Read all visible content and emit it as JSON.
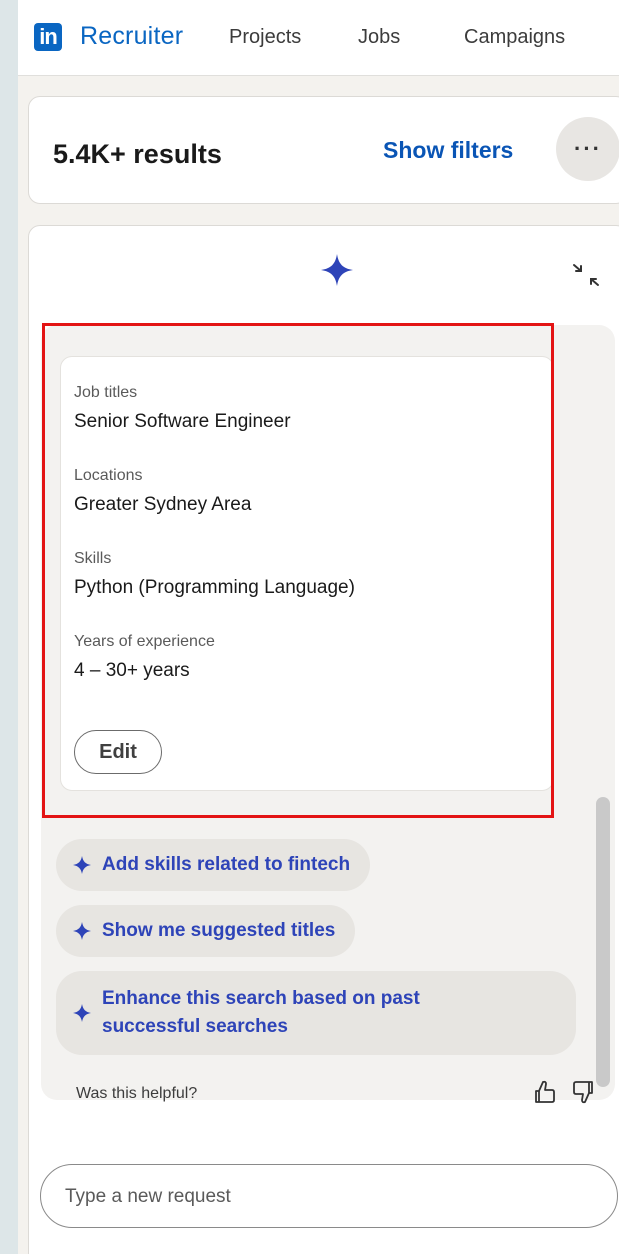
{
  "nav": {
    "logo_text": "in",
    "brand": "Recruiter",
    "links": [
      "Projects",
      "Jobs",
      "Campaigns"
    ]
  },
  "results": {
    "count": "5.4K+ results",
    "show_filters": "Show filters",
    "more_label": "···"
  },
  "criteria": {
    "items": [
      {
        "label": "Job titles",
        "value": "Senior Software Engineer"
      },
      {
        "label": "Locations",
        "value": "Greater Sydney Area"
      },
      {
        "label": "Skills",
        "value": "Python (Programming Language)"
      },
      {
        "label": "Years of experience",
        "value": "4 – 30+ years"
      }
    ],
    "edit_label": "Edit"
  },
  "suggestions": [
    "Add skills related to fintech",
    "Show me suggested titles",
    "Enhance this search based on past successful searches"
  ],
  "feedback": {
    "question": "Was this helpful?"
  },
  "input": {
    "placeholder": "Type a new request"
  },
  "colors": {
    "brand": "#0a66c2",
    "accent": "#2e44b8",
    "highlight": "#e31414"
  }
}
